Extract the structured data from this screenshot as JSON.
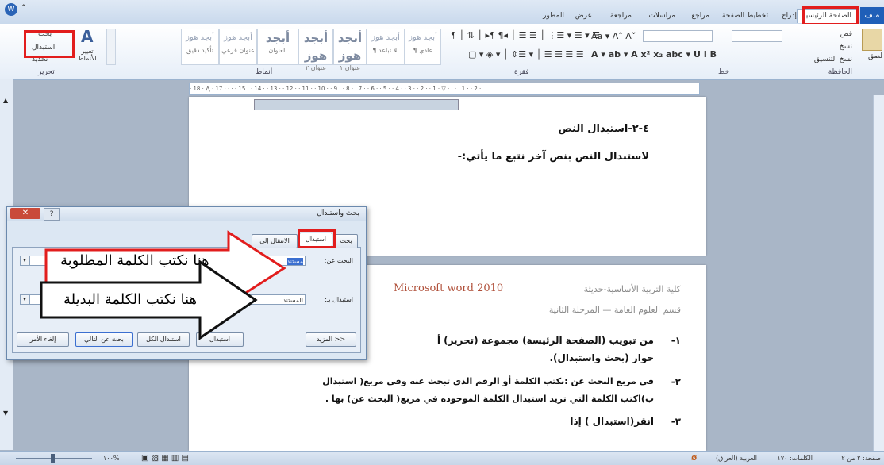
{
  "tabs": {
    "file": "ملف",
    "home": "الصفحة الرئيسية",
    "insert": "إدراج",
    "page_layout": "تخطيط الصفحة",
    "references": "مراجع",
    "mailings": "مراسلات",
    "review": "مراجعة",
    "view": "عرض",
    "developer": "المطور"
  },
  "ribbon": {
    "clipboard": {
      "label": "الحافظة",
      "paste": "لصق",
      "cut": "قص",
      "copy": "نسخ",
      "format_painter": "نسخ التنسيق"
    },
    "font": {
      "label": "خط"
    },
    "paragraph": {
      "label": "فقرة"
    },
    "styles": {
      "label": "أنماط",
      "items": [
        {
          "sample": "أبجد هوز",
          "name": "¶ عادي",
          "big": false
        },
        {
          "sample": "أبجد هوز",
          "name": "¶ بلا تباعد",
          "big": false
        },
        {
          "sample": "أبجد هوز",
          "name": "عنوان ١",
          "big": true
        },
        {
          "sample": "أبجد هوز",
          "name": "عنوان ٢",
          "big": true
        },
        {
          "sample": "أبجد",
          "name": "العنوان",
          "big": true
        },
        {
          "sample": "أبجد هوز",
          "name": "عنوان فرعي",
          "big": false
        },
        {
          "sample": "أبجد هوز",
          "name": "تأكيد دقيق",
          "big": false
        }
      ],
      "change_styles": "تغيير الأنماط"
    },
    "editing": {
      "label": "تحرير",
      "find": "بحث",
      "replace": "استبدال",
      "select": "تحديد"
    }
  },
  "ruler_text": "· 18 · ⋀ · 17 · ·  · · 15 · · 14 · · 13 · · 12 · · 11 · · 10 · · 9 · · 8 · · 7 · · 6 · · 5 · · 4 · · 3 · · 2 · · 1 · ▽ · ·  · · 1 · · 2 ·",
  "page1": {
    "heading": "٤-٢-استبدال النص",
    "body": "لاستبدال النص بنص آخر نتبع ما يأتي:-"
  },
  "page2": {
    "college": "كلية التربية الأساسية-حديثة",
    "program": "Microsoft word 2010",
    "dept": "قسم العلوم العامة — المرحلة الثانية",
    "item1_num": "١-",
    "item1_a": "من تبويب (الصفحة الرئيسة) مجموعة (تحرير) أ",
    "item1_b": "حوار (بحث واستبدال).",
    "item2_num": "٢-",
    "item2_a": "في مربع البحث عن :نكتب الكلمة أو الرقم الذي تبحث عنه وفي مربع( استبدال",
    "item2_b": "ب)اكتب الكلمة التي تريد استبدال الكلمة الموجوده في مربع( البحث عن) بها .",
    "item3_num": "٣-",
    "item3": "انقر(استبدال ) إذا"
  },
  "dialog": {
    "title": "بحث واستبدال",
    "tab_find": "بحث",
    "tab_replace": "استبدال",
    "tab_goto": "الانتقال إلى",
    "find_label": "البحث عن:",
    "find_value": "مستند",
    "replace_label": "استبدال بـ:",
    "replace_value": "المستند",
    "more_btn": "المزيد >>",
    "replace_btn": "استبدال",
    "replace_all_btn": "استبدال الكل",
    "find_next_btn": "بحث عن التالي",
    "cancel_btn": "إلغاء الأمر"
  },
  "callouts": {
    "find_hint": "هنا نكتب الكلمة المطلوبة",
    "replace_hint": "هنا نكتب الكلمة البديلة"
  },
  "statusbar": {
    "page": "صفحة: ٢ من ٢",
    "words": "الكلمات: ١٧٠",
    "language": "العربية (العراق)",
    "zoom": "%١٠٠"
  },
  "colors": {
    "highlight_red": "#e21d1d",
    "file_tab": "#1f5fb8",
    "program_text": "#b0503a"
  }
}
